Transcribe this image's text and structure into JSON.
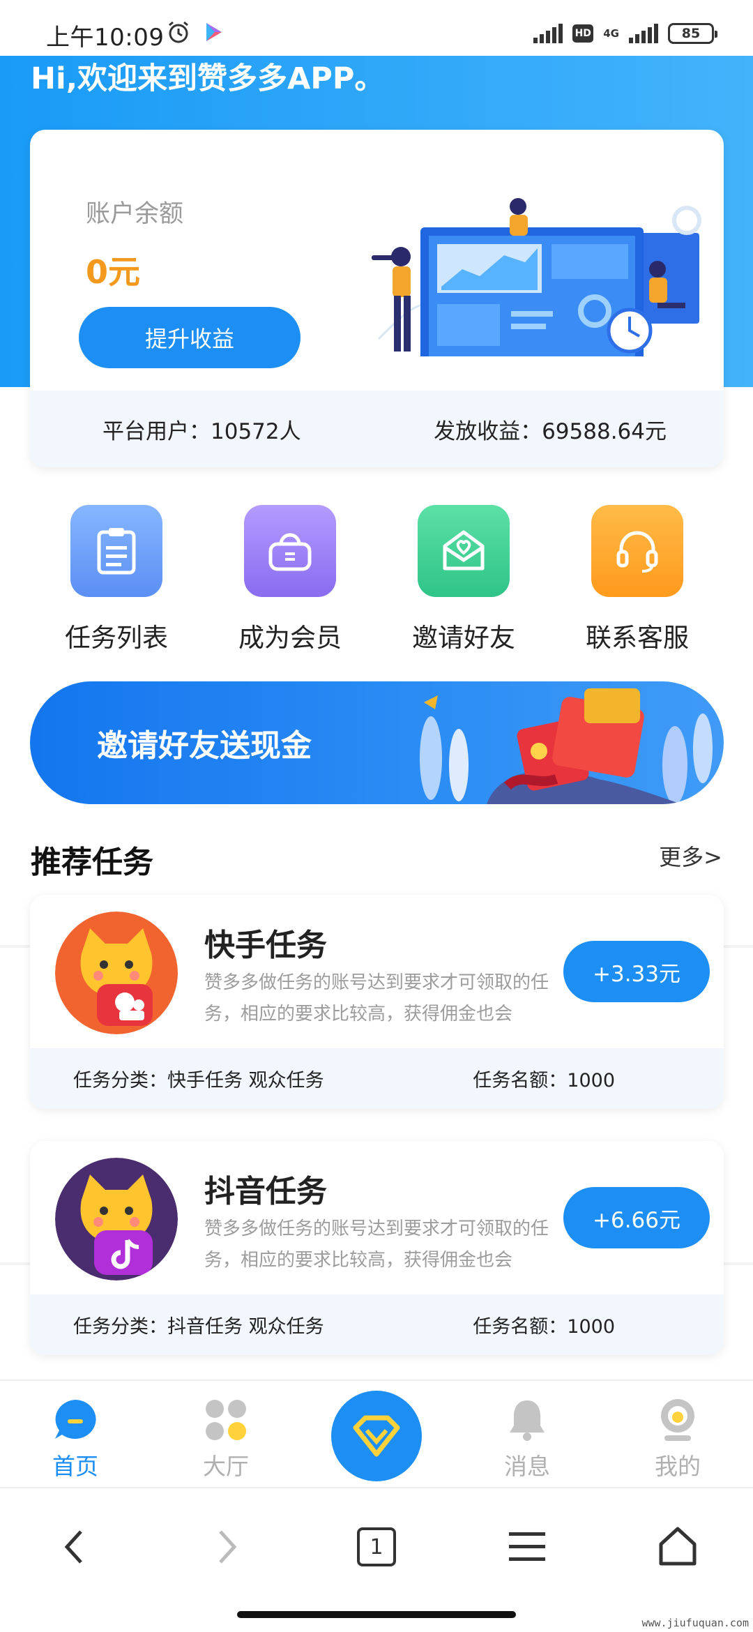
{
  "status_bar": {
    "time": "上午10:09",
    "hd": "HD",
    "network": "4G",
    "battery": "85"
  },
  "header": {
    "greeting": "Hi,欢迎来到赞多多APP。"
  },
  "account": {
    "balance_label": "账户余额",
    "balance_value": "0元",
    "upgrade_button": "提升收益",
    "platform_users": "平台用户：10572人",
    "paid_earnings": "发放收益：69588.64元"
  },
  "actions": [
    {
      "label": "任务列表",
      "icon": "clipboard-icon",
      "color": "#6a9ef8"
    },
    {
      "label": "成为会员",
      "icon": "basket-icon",
      "color": "#9b7cf4"
    },
    {
      "label": "邀请好友",
      "icon": "heart-envelope-icon",
      "color": "#3ed193"
    },
    {
      "label": "联系客服",
      "icon": "headset-icon",
      "color": "#ffa62b"
    }
  ],
  "banner": {
    "text": "邀请好友送现金"
  },
  "recommended": {
    "title": "推荐任务",
    "more": "更多>",
    "tasks": [
      {
        "name": "快手任务",
        "desc": "赞多多做任务的账号达到要求才可领取的任务，相应的要求比较高，获得佣金也会",
        "reward": "+3.33元",
        "category": "任务分类：快手任务 观众任务",
        "quota": "任务名额：1000"
      },
      {
        "name": "抖音任务",
        "desc": "赞多多做任务的账号达到要求才可领取的任务，相应的要求比较高，获得佣金也会",
        "reward": "+6.66元",
        "category": "任务分类：抖音任务 观众任务",
        "quota": "任务名额：1000"
      }
    ]
  },
  "tabbar": [
    {
      "label": "首页",
      "icon": "home-chat-icon",
      "active": true
    },
    {
      "label": "大厅",
      "icon": "hall-dots-icon",
      "active": false
    },
    {
      "label": "",
      "icon": "diamond-icon",
      "active": false
    },
    {
      "label": "消息",
      "icon": "bell-icon",
      "active": false
    },
    {
      "label": "我的",
      "icon": "profile-icon",
      "active": false
    }
  ],
  "navbar": {
    "tab_count": "1"
  },
  "watermark": "www.jiufuquan.com",
  "colors": {
    "primary": "#1d8ef3",
    "balance": "#f39a1e",
    "light_panel": "#f2f7fd"
  }
}
